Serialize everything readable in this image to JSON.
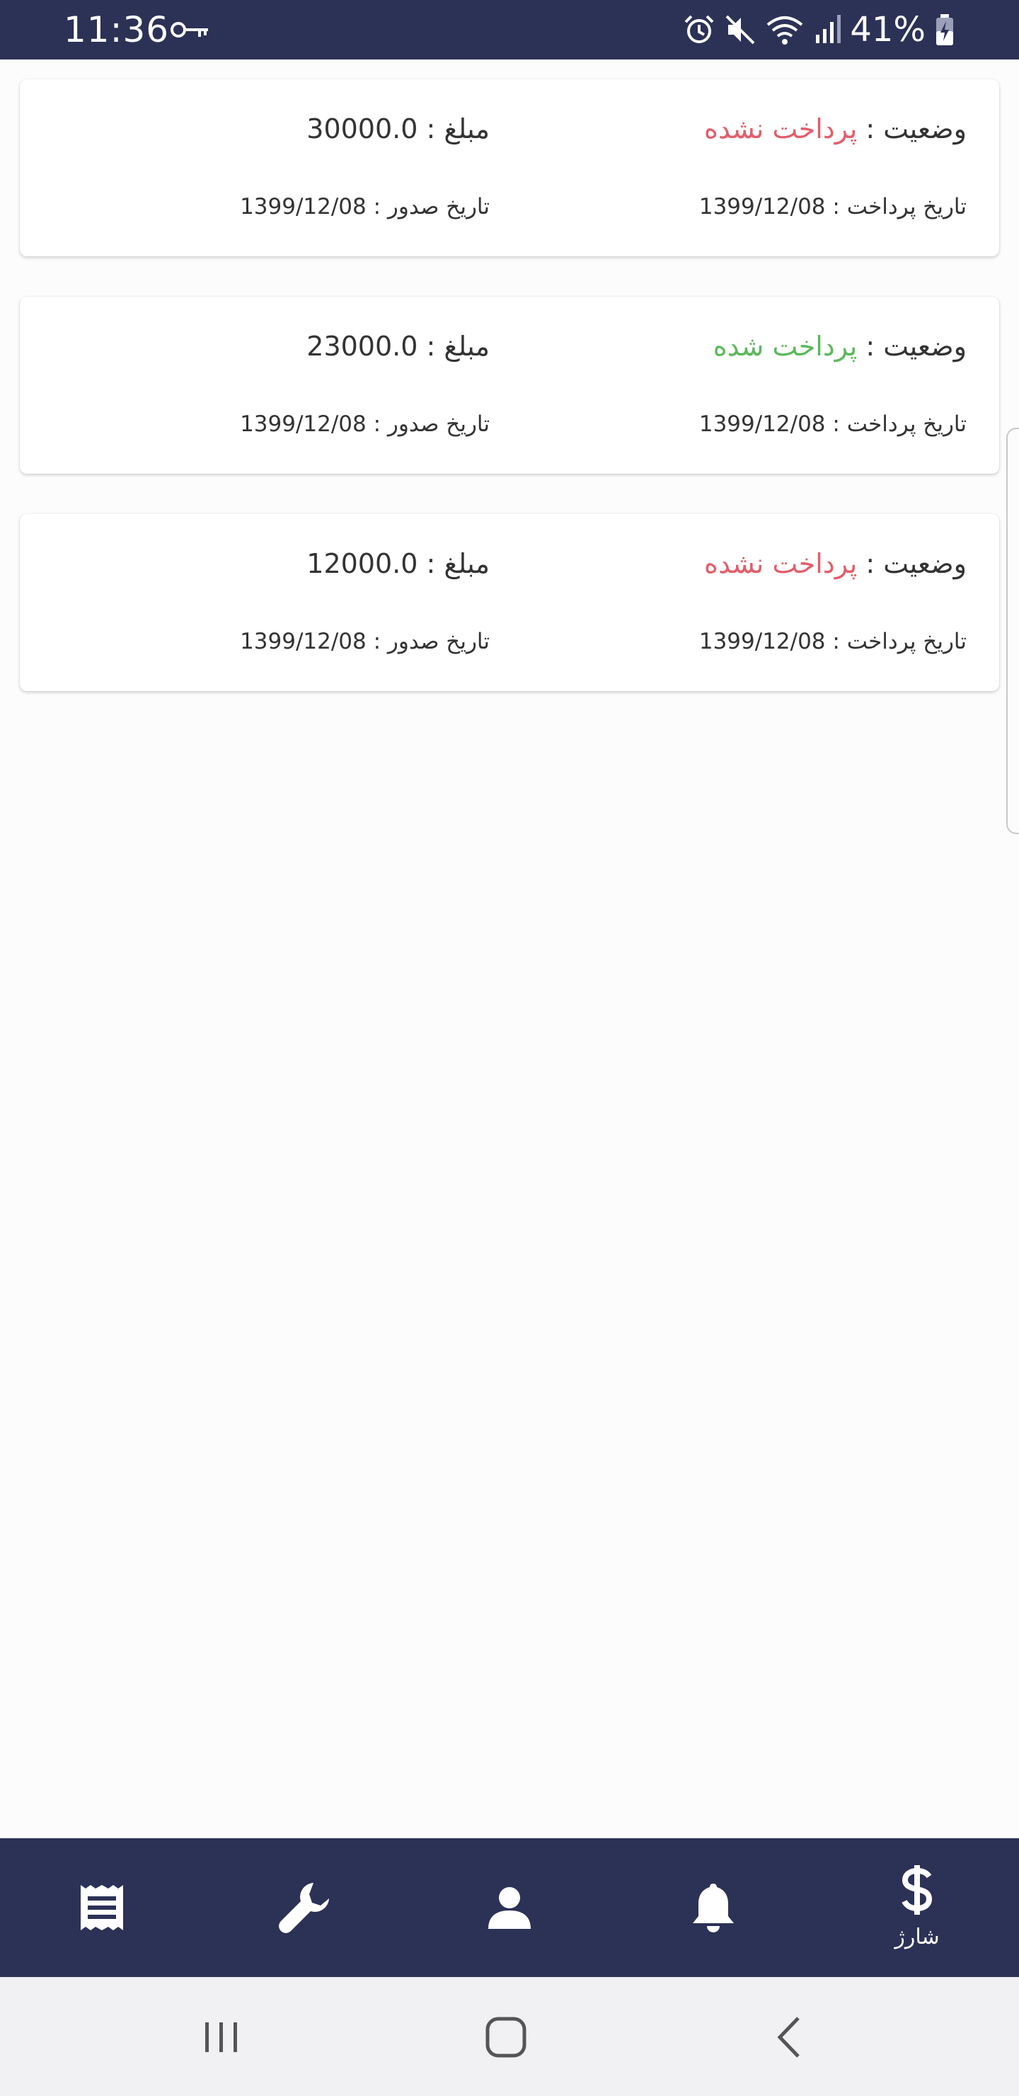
{
  "status_bar": {
    "time": "11:36",
    "battery": "41%",
    "icons": [
      "key-icon",
      "alarm-icon",
      "mute-icon",
      "wifi-icon",
      "signal-icon",
      "battery-icon"
    ]
  },
  "invoices": [
    {
      "status_label": "وضعیت : ",
      "status_value": "پرداخت نشده",
      "status_color": "#e35d6a",
      "amount_label": "مبلغ : ",
      "amount": "30000.0",
      "pay_date_label": "تاریخ پرداخت : ",
      "pay_date": "1399/12/08",
      "issue_date_label": "تاریخ صدور : ",
      "issue_date": "1399/12/08"
    },
    {
      "status_label": "وضعیت : ",
      "status_value": "پرداخت شده",
      "status_color": "#5cb85c",
      "amount_label": "مبلغ : ",
      "amount": "23000.0",
      "pay_date_label": "تاریخ پرداخت : ",
      "pay_date": "1399/12/08",
      "issue_date_label": "تاریخ صدور : ",
      "issue_date": "1399/12/08"
    },
    {
      "status_label": "وضعیت : ",
      "status_value": "پرداخت نشده",
      "status_color": "#e35d6a",
      "amount_label": "مبلغ : ",
      "amount": "12000.0",
      "pay_date_label": "تاریخ پرداخت : ",
      "pay_date": "1399/12/08",
      "issue_date_label": "تاریخ صدور : ",
      "issue_date": "1399/12/08"
    }
  ],
  "bottom_nav": {
    "items": [
      {
        "icon": "receipt-icon",
        "label": ""
      },
      {
        "icon": "wrench-icon",
        "label": ""
      },
      {
        "icon": "person-icon",
        "label": ""
      },
      {
        "icon": "bell-icon",
        "label": ""
      },
      {
        "icon": "dollar-icon",
        "label": "شارژ"
      }
    ]
  },
  "colors": {
    "primary": "#2c3156",
    "unpaid": "#e35d6a",
    "paid": "#5cb85c"
  }
}
